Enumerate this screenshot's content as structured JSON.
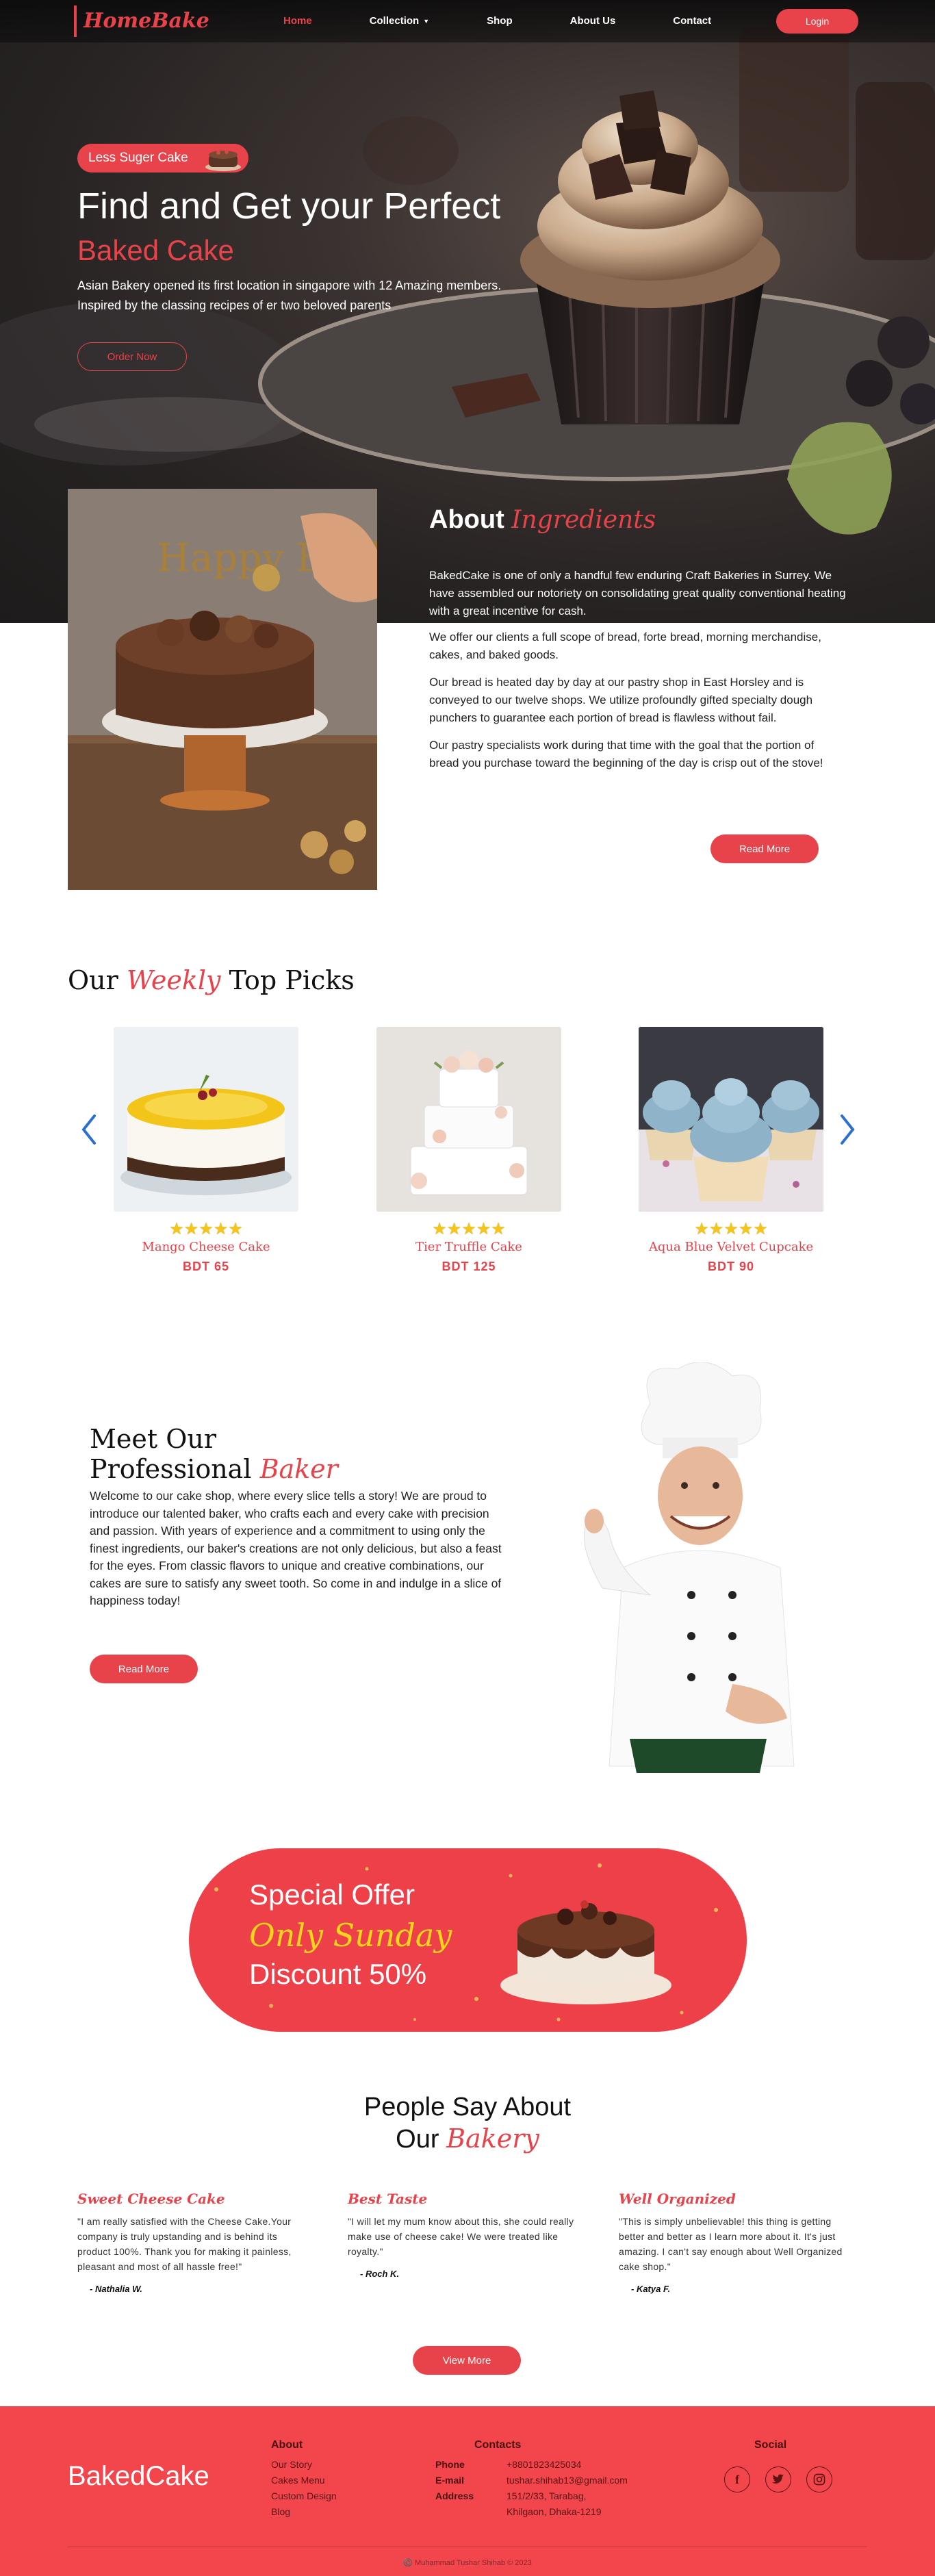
{
  "nav": {
    "logo": "HomeBake",
    "links": [
      "Home",
      "Collection",
      "Shop",
      "About Us",
      "Contact"
    ],
    "login": "Login"
  },
  "hero": {
    "pill": "Less Suger Cake",
    "title": "Find and Get your Perfect",
    "subtitle": "Baked Cake",
    "description": "Asian Bakery opened its first location in singapore with 12 Amazing members. Inspired by the classing recipes of er two beloved parents",
    "order_button": "Order Now"
  },
  "about": {
    "title_plain": "About",
    "title_script": "Ingredients",
    "paragraphs": [
      "BakedCake is one of only a handful few enduring Craft Bakeries in Surrey. We have assembled our notoriety on consolidating great quality conventional heating with a great incentive for cash.",
      "We offer our clients a full scope of bread, forte bread, morning merchandise, cakes, and baked goods.",
      "Our bread is heated day by day at our pastry shop in East Horsley and is conveyed to our twelve shops. We utilize profoundly gifted specialty dough punchers to guarantee each portion of bread is flawless without fail.",
      "Our pastry specialists work during that time with the goal that the portion of bread you purchase toward the beginning of the day is crisp out of the stove!"
    ],
    "read_more": "Read More",
    "image_text": "Happy Birthday"
  },
  "picks": {
    "title_a": "Our",
    "title_script": "Weekly",
    "title_b": "Top Picks",
    "stars": "★★★★★",
    "items": [
      {
        "name": "Mango Cheese Cake",
        "price": "BDT 65",
        "rating": 5
      },
      {
        "name": "Tier Truffle Cake",
        "price": "BDT 125",
        "rating": 5
      },
      {
        "name": "Aqua Blue Velvet Cupcake",
        "price": "BDT 90",
        "rating": 5
      }
    ]
  },
  "baker": {
    "line1": "Meet Our",
    "line2": "Professional",
    "script": "Baker",
    "description": "Welcome to our cake shop, where every slice tells a story! We are proud to introduce our talented baker, who crafts each and every cake with precision and passion. With years of experience and a commitment to using only the finest ingredients, our baker's creations are not only delicious, but also a feast for the eyes. From classic flavors to unique and creative combinations, our cakes are sure to satisfy any sweet tooth. So come in and indulge in a slice of happiness today!",
    "read_more": "Read More"
  },
  "offer": {
    "line1": "Special Offer",
    "line2": "Only Sunday",
    "line3": "Discount 50%"
  },
  "testimonials": {
    "title_a": "People Say About",
    "title_b": "Our",
    "title_script": "Bakery",
    "items": [
      {
        "heading": "Sweet Cheese Cake",
        "text": "\"I am really satisfied with the Cheese Cake.Your company is truly upstanding and is behind its product 100%. Thank you for making it painless, pleasant and most of all hassle free!\"",
        "author": "- Nathalia W."
      },
      {
        "heading": "Best Taste",
        "text": "\"I will let my mum know about this, she could really make use of cheese cake! We were treated like royalty.\"",
        "author": "- Roch K."
      },
      {
        "heading": "Well Organized",
        "text": "\"This is simply unbelievable! this thing is getting better and better as I learn more about it. It's just amazing. I can't say enough about Well Organized cake shop.\"",
        "author": "- Katya F."
      }
    ],
    "view_more": "View More"
  },
  "footer": {
    "brand": "BakedCake",
    "about_title": "About",
    "about_links": [
      "Our Story",
      "Cakes Menu",
      "Custom Design",
      "Blog"
    ],
    "contact_title": "Contacts",
    "contact_labels": [
      "Phone",
      "E-mail",
      "Address"
    ],
    "phone": "+8801823425034",
    "email": "tushar.shihab13@gmail.com",
    "address_1": "151/2/33, Tarabag,",
    "address_2": "Khilgaon, Dhaka-1219",
    "social_title": "Social",
    "copyright": "©️ Muhammad Tushar Shihab © 2023"
  },
  "colors": {
    "accent": "#e8424a",
    "footer": "#f2454c",
    "star": "#f5c518",
    "offer_script": "#f7d51c"
  }
}
